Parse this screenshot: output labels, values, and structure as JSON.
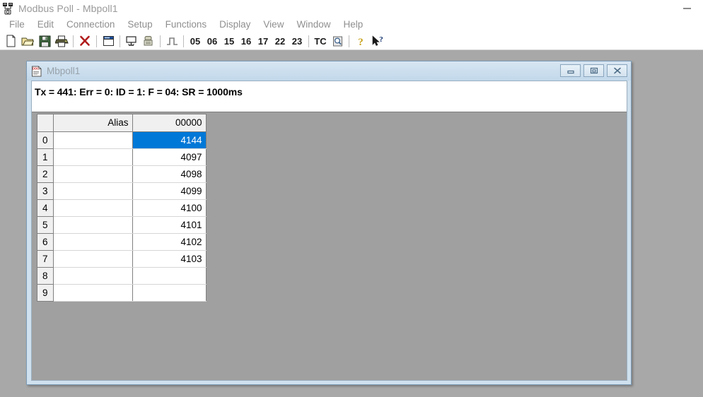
{
  "window": {
    "title": "Modbus Poll - Mbpoll1",
    "app_icon": "modbus-poll-icon",
    "minimize_label": "–"
  },
  "menu": {
    "items": [
      {
        "label": "File"
      },
      {
        "label": "Edit"
      },
      {
        "label": "Connection"
      },
      {
        "label": "Setup"
      },
      {
        "label": "Functions"
      },
      {
        "label": "Display"
      },
      {
        "label": "View"
      },
      {
        "label": "Window"
      },
      {
        "label": "Help"
      }
    ]
  },
  "toolbar": {
    "buttons": [
      {
        "name": "new-icon",
        "kind": "icon",
        "label": ""
      },
      {
        "name": "open-icon",
        "kind": "icon",
        "label": ""
      },
      {
        "name": "save-icon",
        "kind": "icon",
        "label": ""
      },
      {
        "name": "print-icon",
        "kind": "icon",
        "label": ""
      },
      {
        "name": "separator",
        "kind": "sep",
        "label": ""
      },
      {
        "name": "delete-icon",
        "kind": "icon",
        "label": ""
      },
      {
        "name": "separator",
        "kind": "sep",
        "label": ""
      },
      {
        "name": "window-icon",
        "kind": "icon",
        "label": ""
      },
      {
        "name": "separator",
        "kind": "sep",
        "label": ""
      },
      {
        "name": "read-write-definition-icon",
        "kind": "icon",
        "label": ""
      },
      {
        "name": "print-preview-icon",
        "kind": "icon",
        "label": ""
      },
      {
        "name": "separator",
        "kind": "sep",
        "label": ""
      },
      {
        "name": "pulse-icon",
        "kind": "icon",
        "label": ""
      },
      {
        "name": "separator",
        "kind": "sep",
        "label": ""
      },
      {
        "name": "function-05-button",
        "kind": "text",
        "label": "05"
      },
      {
        "name": "function-06-button",
        "kind": "text",
        "label": "06"
      },
      {
        "name": "function-15-button",
        "kind": "text",
        "label": "15"
      },
      {
        "name": "function-16-button",
        "kind": "text",
        "label": "16"
      },
      {
        "name": "function-17-button",
        "kind": "text",
        "label": "17"
      },
      {
        "name": "function-22-button",
        "kind": "text",
        "label": "22"
      },
      {
        "name": "function-23-button",
        "kind": "text",
        "label": "23"
      },
      {
        "name": "separator",
        "kind": "sep",
        "label": ""
      },
      {
        "name": "tc-button",
        "kind": "text",
        "label": "TC"
      },
      {
        "name": "magnifier-document-icon",
        "kind": "icon",
        "label": ""
      },
      {
        "name": "separator",
        "kind": "sep",
        "label": ""
      },
      {
        "name": "help-icon",
        "kind": "icon",
        "label": ""
      },
      {
        "name": "whats-this-icon",
        "kind": "icon",
        "label": ""
      }
    ]
  },
  "mdi_window": {
    "title": "Mbpoll1",
    "icon": "document-doc-icon",
    "minimize_label": "–",
    "restore_label": "❐",
    "close_label": "✕",
    "status_line": "Tx = 441: Err = 0: ID = 1: F = 04: SR = 1000ms",
    "status_fields": {
      "tx": "441",
      "err": "0",
      "id": "1",
      "f": "04",
      "sr": "1000ms"
    }
  },
  "grid": {
    "columns": [
      {
        "key": "rowhdr",
        "label": ""
      },
      {
        "key": "alias",
        "label": "Alias"
      },
      {
        "key": "data",
        "label": "00000"
      }
    ],
    "selected_cell": {
      "row": 0,
      "column": "data"
    },
    "rows": [
      {
        "index": "0",
        "alias": "",
        "value": "4144"
      },
      {
        "index": "1",
        "alias": "",
        "value": "4097"
      },
      {
        "index": "2",
        "alias": "",
        "value": "4098"
      },
      {
        "index": "3",
        "alias": "",
        "value": "4099"
      },
      {
        "index": "4",
        "alias": "",
        "value": "4100"
      },
      {
        "index": "5",
        "alias": "",
        "value": "4101"
      },
      {
        "index": "6",
        "alias": "",
        "value": "4102"
      },
      {
        "index": "7",
        "alias": "",
        "value": "4103"
      },
      {
        "index": "8",
        "alias": "",
        "value": ""
      },
      {
        "index": "9",
        "alias": "",
        "value": ""
      }
    ]
  },
  "colors": {
    "selection": "#0078d7",
    "mdi_titlebar": "#cbdeee",
    "mdi_client": "#a0a0a0",
    "app_background": "#a8a8a8",
    "chrome": "#ffffff"
  }
}
